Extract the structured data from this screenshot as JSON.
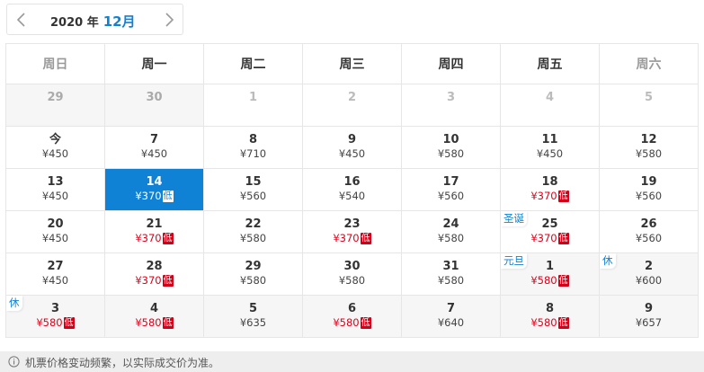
{
  "header": {
    "year_label": "2020 年",
    "month_label": "12月"
  },
  "weekdays": [
    "周日",
    "周一",
    "周二",
    "周三",
    "周四",
    "周五",
    "周六"
  ],
  "weeks": [
    [
      {
        "day": "29",
        "price": "",
        "state": "out"
      },
      {
        "day": "30",
        "price": "",
        "state": "out"
      },
      {
        "day": "1",
        "price": "",
        "state": "dim-blank"
      },
      {
        "day": "2",
        "price": "",
        "state": "dim-blank"
      },
      {
        "day": "3",
        "price": "",
        "state": "dim-blank"
      },
      {
        "day": "4",
        "price": "",
        "state": "dim-blank"
      },
      {
        "day": "5",
        "price": "",
        "state": "dim-blank"
      }
    ],
    [
      {
        "day": "今",
        "price": "¥450"
      },
      {
        "day": "7",
        "price": "¥450"
      },
      {
        "day": "8",
        "price": "¥710"
      },
      {
        "day": "9",
        "price": "¥450"
      },
      {
        "day": "10",
        "price": "¥580"
      },
      {
        "day": "11",
        "price": "¥450"
      },
      {
        "day": "12",
        "price": "¥580"
      }
    ],
    [
      {
        "day": "13",
        "price": "¥450"
      },
      {
        "day": "14",
        "price": "¥370",
        "low": "低",
        "state": "selected"
      },
      {
        "day": "15",
        "price": "¥560"
      },
      {
        "day": "16",
        "price": "¥540"
      },
      {
        "day": "17",
        "price": "¥560"
      },
      {
        "day": "18",
        "price": "¥370",
        "low": "低"
      },
      {
        "day": "19",
        "price": "¥560"
      }
    ],
    [
      {
        "day": "20",
        "price": "¥450"
      },
      {
        "day": "21",
        "price": "¥370",
        "low": "低"
      },
      {
        "day": "22",
        "price": "¥580"
      },
      {
        "day": "23",
        "price": "¥370",
        "low": "低"
      },
      {
        "day": "24",
        "price": "¥580"
      },
      {
        "day": "25",
        "price": "¥370",
        "low": "低",
        "holiday": "圣诞"
      },
      {
        "day": "26",
        "price": "¥560"
      }
    ],
    [
      {
        "day": "27",
        "price": "¥450"
      },
      {
        "day": "28",
        "price": "¥370",
        "low": "低"
      },
      {
        "day": "29",
        "price": "¥580"
      },
      {
        "day": "30",
        "price": "¥580"
      },
      {
        "day": "31",
        "price": "¥580"
      },
      {
        "day": "1",
        "price": "¥580",
        "low": "低",
        "holiday": "元旦",
        "state": "next"
      },
      {
        "day": "2",
        "price": "¥600",
        "holiday": "休",
        "state": "next"
      }
    ],
    [
      {
        "day": "3",
        "price": "¥580",
        "low": "低",
        "holiday": "休",
        "state": "next"
      },
      {
        "day": "4",
        "price": "¥580",
        "low": "低",
        "state": "next"
      },
      {
        "day": "5",
        "price": "¥635",
        "state": "next"
      },
      {
        "day": "6",
        "price": "¥580",
        "low": "低",
        "state": "next"
      },
      {
        "day": "7",
        "price": "¥640",
        "state": "next"
      },
      {
        "day": "8",
        "price": "¥580",
        "low": "低",
        "state": "next"
      },
      {
        "day": "9",
        "price": "¥657",
        "state": "next"
      }
    ]
  ],
  "footer": {
    "note": "机票价格变动频繁，以实际成交价为准。"
  },
  "colors": {
    "accent": "#0f82d6",
    "low_price": "#e0001a",
    "low_badge": "#d40018"
  },
  "icons": {
    "prev": "chevron-left-icon",
    "next": "chevron-right-icon",
    "info": "info-icon"
  }
}
